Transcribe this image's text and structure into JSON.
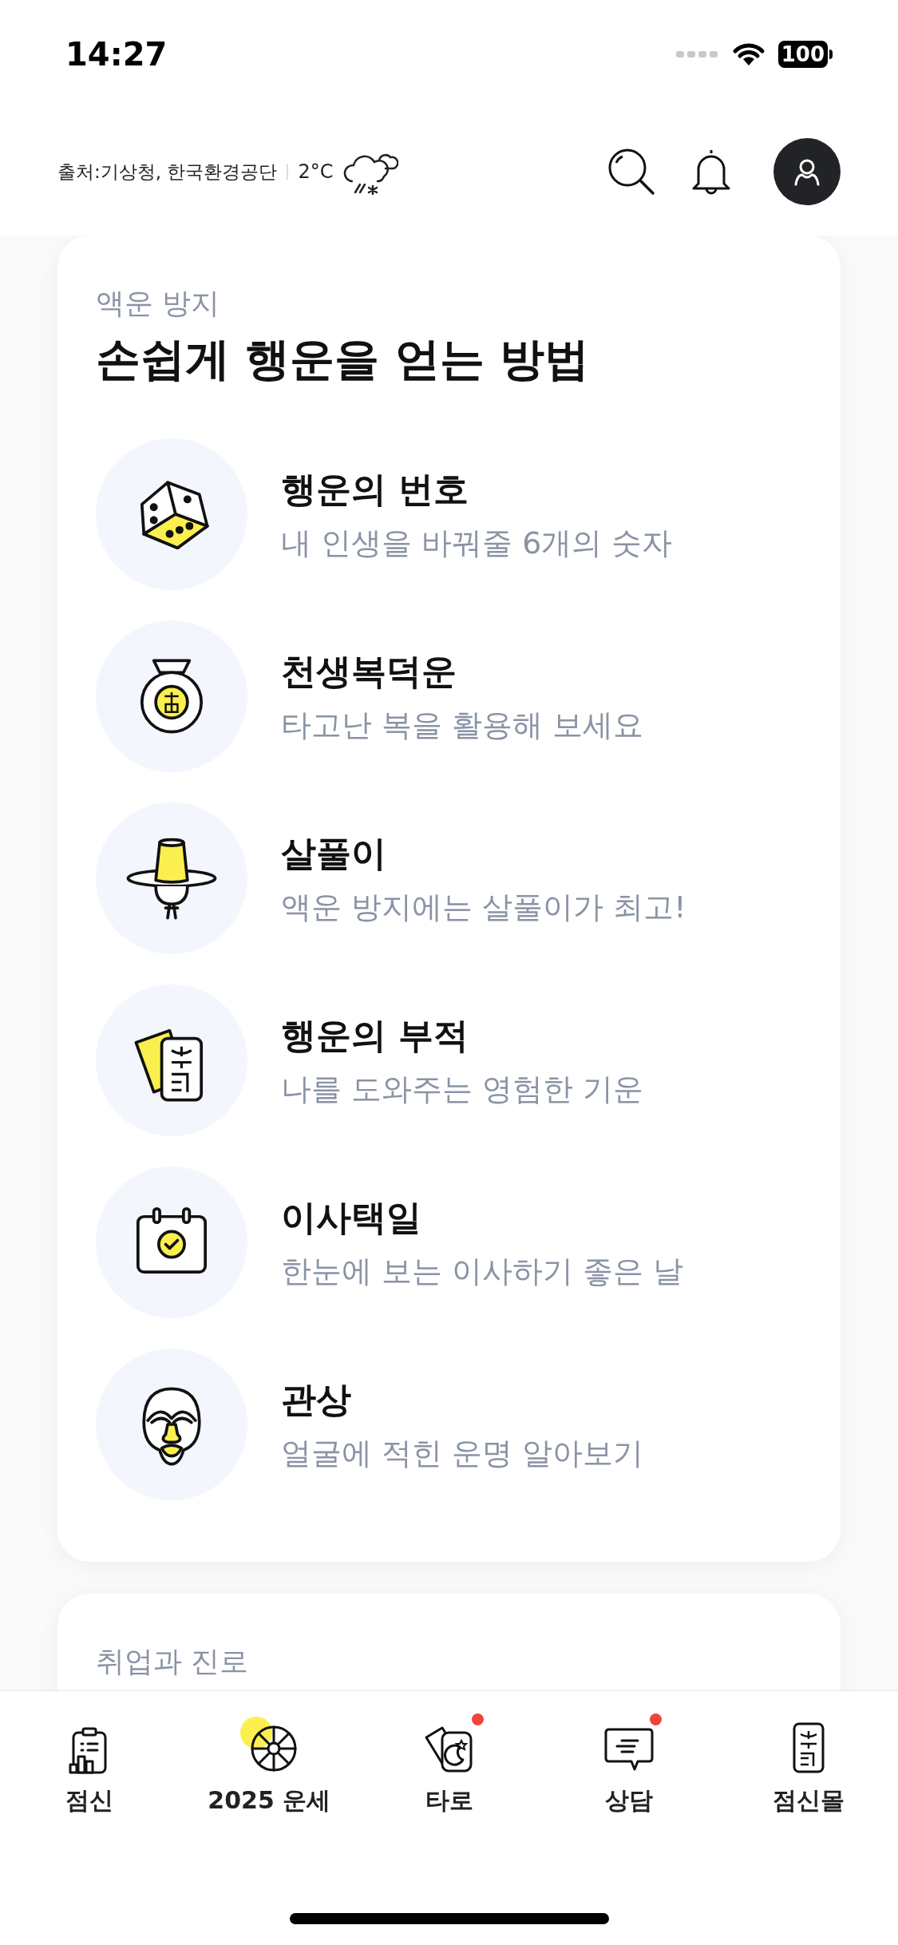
{
  "status_bar": {
    "time": "14:27",
    "battery": "100"
  },
  "header": {
    "weather_source": "출처:기상청, 한국환경공단",
    "temperature": "2°C"
  },
  "cards": [
    {
      "eyebrow": "액운 방지",
      "title": "손쉽게 행운을 얻는 방법",
      "items": [
        {
          "kind": "dice",
          "title": "행운의 번호",
          "subtitle": "내 인생을 바꿔줄 6개의 숫자"
        },
        {
          "kind": "pouch",
          "title": "천생복덕운",
          "subtitle": "타고난 복을 활용해 보세요"
        },
        {
          "kind": "hat",
          "title": "살풀이",
          "subtitle": "액운 방지에는 살풀이가 최고!"
        },
        {
          "kind": "talisman",
          "title": "행운의 부적",
          "subtitle": "나를 도와주는 영험한 기운"
        },
        {
          "kind": "calendar",
          "title": "이사택일",
          "subtitle": "한눈에 보는 이사하기 좋은 날"
        },
        {
          "kind": "mask",
          "title": "관상",
          "subtitle": "얼굴에 적힌 운명 알아보기"
        }
      ]
    },
    {
      "eyebrow": "취업과 진로"
    }
  ],
  "tab_bar": [
    {
      "kind": "clipboard",
      "label": "점신",
      "badge": false
    },
    {
      "kind": "wheel",
      "label": "2025 운세",
      "badge": false
    },
    {
      "kind": "cards",
      "label": "타로",
      "badge": true
    },
    {
      "kind": "chat",
      "label": "상담",
      "badge": true
    },
    {
      "kind": "talisman",
      "label": "점신몰",
      "badge": false
    }
  ]
}
